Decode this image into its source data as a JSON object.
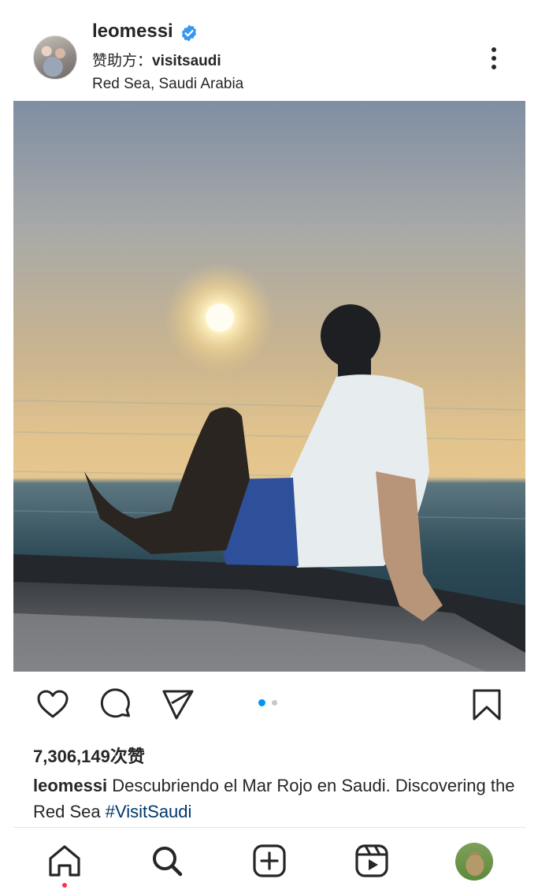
{
  "post": {
    "username": "leomessi",
    "sponsor_prefix": "赞助方：",
    "sponsor_name": "visitsaudi",
    "location": "Red Sea, Saudi Arabia",
    "likes": "7,306,149次赞",
    "caption_text": "Descubriendo el Mar Rojo en Saudi. Discovering the Red Sea",
    "hashtag": "#VisitSaudi",
    "carousel": {
      "count": 2,
      "active_index": 0
    }
  },
  "icons": {
    "verified": "verified-badge-icon",
    "more": "more-options-icon",
    "like": "heart-icon",
    "comment": "comment-bubble-icon",
    "share": "paper-plane-icon",
    "save": "bookmark-icon"
  },
  "bottom_nav": [
    {
      "name": "home",
      "icon": "home-icon"
    },
    {
      "name": "search",
      "icon": "search-icon"
    },
    {
      "name": "create",
      "icon": "plus-square-icon"
    },
    {
      "name": "reels",
      "icon": "reels-icon"
    },
    {
      "name": "profile",
      "icon": "profile-avatar"
    }
  ],
  "colors": {
    "verified_blue": "#3897f0",
    "hashtag": "#00376b",
    "carousel_active": "#0095f6",
    "carousel_inactive": "#c7c7c7",
    "notification_dot": "#ff3040"
  }
}
